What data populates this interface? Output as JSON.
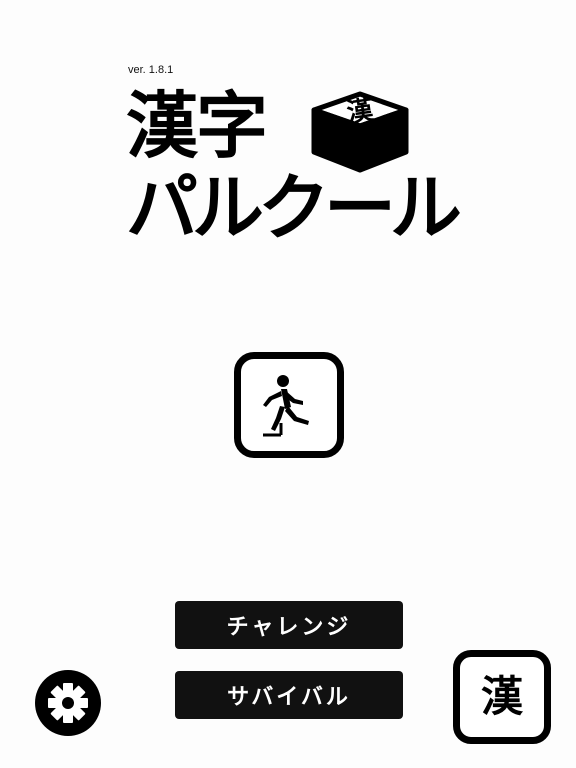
{
  "app": {
    "version": "ver. 1.8.1",
    "logo": {
      "line1": "漢字",
      "line2": "パルクール",
      "cube_char": "漢"
    }
  },
  "buttons": {
    "start": {
      "icon": "running-exit-icon"
    },
    "challenge_label": "チャレンジ",
    "survival_label": "サバイバル",
    "settings": {
      "icon": "gear-icon"
    },
    "kanji_label": "漢"
  },
  "colors": {
    "background": "#fdfdfd",
    "foreground": "#000000",
    "button_fill": "#111111",
    "button_text": "#ffffff"
  }
}
